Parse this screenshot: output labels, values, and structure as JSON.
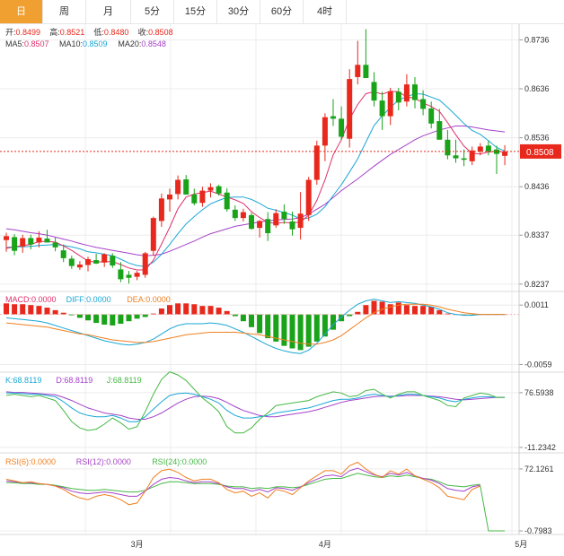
{
  "tabs": [
    {
      "label": "日",
      "active": true
    },
    {
      "label": "周",
      "active": false
    },
    {
      "label": "月",
      "active": false
    },
    {
      "label": "5分",
      "active": false
    },
    {
      "label": "15分",
      "active": false
    },
    {
      "label": "30分",
      "active": false
    },
    {
      "label": "60分",
      "active": false
    },
    {
      "label": "4时",
      "active": false
    }
  ],
  "colors": {
    "up": "#e8281c",
    "down": "#19a319",
    "ma5": "#e0306a",
    "ma10": "#1aa7d6",
    "ma20": "#a542c8",
    "macd": "#e0306a",
    "diff": "#1aa7d6",
    "dea": "#f08020",
    "k": "#1aa7d6",
    "d": "#a542c8",
    "j": "#45b845",
    "rsi6": "#f08020",
    "rsi12": "#a542c8",
    "rsi24": "#45b845",
    "accent": "#f0a030",
    "grid": "#ececec"
  },
  "legend": {
    "ohlc": [
      {
        "label": "开:",
        "value": "0.8499"
      },
      {
        "label": "高:",
        "value": "0.8521"
      },
      {
        "label": "低:",
        "value": "0.8480"
      },
      {
        "label": "收:",
        "value": "0.8508"
      }
    ],
    "ma": [
      {
        "label": "MA5:",
        "value": "0.8507",
        "color": "#e0306a"
      },
      {
        "label": "MA10:",
        "value": "0.8509",
        "color": "#1aa7d6"
      },
      {
        "label": "MA20:",
        "value": "0.8548",
        "color": "#a542c8"
      }
    ],
    "macd": [
      {
        "text": "MACD:0.0000",
        "color": "#e0306a"
      },
      {
        "text": "DIFF:0.0000",
        "color": "#1aa7d6"
      },
      {
        "text": "DEA:0.0000",
        "color": "#f08020"
      }
    ],
    "kdj": [
      {
        "text": "K:68.8119",
        "color": "#1aa7d6"
      },
      {
        "text": "D:68.8119",
        "color": "#a542c8"
      },
      {
        "text": "J:68.8119",
        "color": "#45b845"
      }
    ],
    "rsi": [
      {
        "text": "RSI(6):0.0000",
        "color": "#f08020"
      },
      {
        "text": "RSI(12):0.0000",
        "color": "#a542c8"
      },
      {
        "text": "RSI(24):0.0000",
        "color": "#45b845"
      }
    ]
  },
  "chart_data": {
    "type": "candlestick",
    "current_price": "0.8508",
    "x_labels": [
      {
        "i": 16,
        "text": "3月"
      },
      {
        "i": 39,
        "text": "4月"
      },
      {
        "i": 63,
        "text": "5月"
      }
    ],
    "price_axis": {
      "ticks": [
        "0.8736",
        "0.8636",
        "0.8536",
        "0.8436",
        "0.8337",
        "0.8237"
      ],
      "range": [
        0.8222,
        0.8768
      ]
    },
    "macd_axis": {
      "ticks": [
        "0.0011",
        "-0.0059"
      ],
      "range": [
        -0.0068,
        0.0026
      ]
    },
    "kdj_axis": {
      "ticks": [
        "76.5938",
        "-11.2342"
      ],
      "range": [
        -20,
        108
      ]
    },
    "rsi_axis": {
      "ticks": [
        "72.1261",
        "-0.7983"
      ],
      "range": [
        -5,
        90
      ]
    },
    "candles": [
      [
        0.8327,
        0.8342,
        0.8303,
        0.8335
      ],
      [
        0.8333,
        0.8339,
        0.8296,
        0.8305
      ],
      [
        0.8314,
        0.8338,
        0.8301,
        0.8331
      ],
      [
        0.8331,
        0.8338,
        0.8308,
        0.8318
      ],
      [
        0.8322,
        0.8345,
        0.8312,
        0.8332
      ],
      [
        0.833,
        0.8348,
        0.8322,
        0.8322
      ],
      [
        0.8322,
        0.8332,
        0.8304,
        0.8312
      ],
      [
        0.8306,
        0.8318,
        0.8282,
        0.829
      ],
      [
        0.8289,
        0.8295,
        0.8268,
        0.8274
      ],
      [
        0.8271,
        0.8284,
        0.8266,
        0.8277
      ],
      [
        0.8276,
        0.8293,
        0.8263,
        0.8288
      ],
      [
        0.8286,
        0.8299,
        0.8278,
        0.8279
      ],
      [
        0.8281,
        0.83,
        0.8272,
        0.8298
      ],
      [
        0.8295,
        0.83,
        0.827,
        0.8275
      ],
      [
        0.8267,
        0.8282,
        0.8241,
        0.8247
      ],
      [
        0.8256,
        0.8264,
        0.8238,
        0.825
      ],
      [
        0.8252,
        0.8264,
        0.8245,
        0.826
      ],
      [
        0.8256,
        0.8303,
        0.825,
        0.83
      ],
      [
        0.8305,
        0.8375,
        0.8295,
        0.8372
      ],
      [
        0.8366,
        0.8422,
        0.8354,
        0.8412
      ],
      [
        0.841,
        0.8432,
        0.8385,
        0.842
      ],
      [
        0.8421,
        0.8459,
        0.841,
        0.845
      ],
      [
        0.8451,
        0.846,
        0.842,
        0.842
      ],
      [
        0.842,
        0.8432,
        0.8398,
        0.8402
      ],
      [
        0.8403,
        0.8436,
        0.8395,
        0.8428
      ],
      [
        0.8428,
        0.8443,
        0.8414,
        0.8435
      ],
      [
        0.8437,
        0.844,
        0.8418,
        0.8422
      ],
      [
        0.8424,
        0.8433,
        0.8385,
        0.839
      ],
      [
        0.8389,
        0.8398,
        0.8366,
        0.8372
      ],
      [
        0.8372,
        0.8391,
        0.8365,
        0.8384
      ],
      [
        0.8378,
        0.8383,
        0.8348,
        0.835
      ],
      [
        0.8352,
        0.8368,
        0.8332,
        0.8366
      ],
      [
        0.837,
        0.8384,
        0.8325,
        0.8341
      ],
      [
        0.8357,
        0.839,
        0.8352,
        0.8382
      ],
      [
        0.8385,
        0.84,
        0.836,
        0.837
      ],
      [
        0.8365,
        0.8385,
        0.8336,
        0.8349
      ],
      [
        0.8352,
        0.8425,
        0.8328,
        0.8381
      ],
      [
        0.8378,
        0.8456,
        0.8366,
        0.845
      ],
      [
        0.845,
        0.853,
        0.844,
        0.852
      ],
      [
        0.852,
        0.8586,
        0.8488,
        0.8578
      ],
      [
        0.858,
        0.8615,
        0.856,
        0.8575
      ],
      [
        0.8575,
        0.86,
        0.8531,
        0.8538
      ],
      [
        0.8534,
        0.8676,
        0.8516,
        0.8656
      ],
      [
        0.866,
        0.8734,
        0.8645,
        0.8685
      ],
      [
        0.8685,
        0.8758,
        0.8662,
        0.8658
      ],
      [
        0.865,
        0.867,
        0.86,
        0.8612
      ],
      [
        0.8612,
        0.863,
        0.8552,
        0.858
      ],
      [
        0.858,
        0.8638,
        0.8562,
        0.8631
      ],
      [
        0.863,
        0.8638,
        0.8592,
        0.8608
      ],
      [
        0.861,
        0.8666,
        0.86,
        0.8645
      ],
      [
        0.8645,
        0.866,
        0.8596,
        0.8613
      ],
      [
        0.8615,
        0.8633,
        0.8582,
        0.8595
      ],
      [
        0.8596,
        0.861,
        0.8555,
        0.8565
      ],
      [
        0.857,
        0.8595,
        0.854,
        0.8532
      ],
      [
        0.8532,
        0.8552,
        0.8492,
        0.85
      ],
      [
        0.85,
        0.8532,
        0.8485,
        0.8494
      ],
      [
        0.8494,
        0.8512,
        0.8478,
        0.8491
      ],
      [
        0.8488,
        0.8518,
        0.848,
        0.851
      ],
      [
        0.8508,
        0.8525,
        0.85,
        0.8518
      ],
      [
        0.852,
        0.853,
        0.85,
        0.8508
      ],
      [
        0.8512,
        0.852,
        0.8462,
        0.8503
      ],
      [
        0.8499,
        0.8521,
        0.848,
        0.8508
      ]
    ],
    "ma5": [
      0.831,
      0.8313,
      0.8316,
      0.8318,
      0.8324,
      0.8324,
      0.8323,
      0.8315,
      0.8306,
      0.8295,
      0.8284,
      0.8282,
      0.8283,
      0.8283,
      0.8277,
      0.827,
      0.8266,
      0.8266,
      0.8286,
      0.8319,
      0.8353,
      0.8391,
      0.8415,
      0.8421,
      0.8424,
      0.8427,
      0.8421,
      0.8415,
      0.8409,
      0.8402,
      0.8385,
      0.8373,
      0.8363,
      0.8361,
      0.8363,
      0.8362,
      0.8364,
      0.8378,
      0.8408,
      0.845,
      0.8501,
      0.8532,
      0.8574,
      0.8604,
      0.8626,
      0.863,
      0.8625,
      0.8631,
      0.863,
      0.8619,
      0.8617,
      0.8607,
      0.86,
      0.859,
      0.8567,
      0.8542,
      0.8519,
      0.8504,
      0.8503,
      0.8507,
      0.8508,
      0.8507
    ],
    "ma10": [
      0.8312,
      0.8313,
      0.8313,
      0.8314,
      0.8316,
      0.8317,
      0.8318,
      0.8316,
      0.8313,
      0.8309,
      0.8303,
      0.8301,
      0.8298,
      0.8295,
      0.8288,
      0.828,
      0.8275,
      0.8273,
      0.8282,
      0.8298,
      0.8318,
      0.834,
      0.836,
      0.8375,
      0.8389,
      0.8401,
      0.8408,
      0.8414,
      0.8415,
      0.8415,
      0.841,
      0.8402,
      0.8392,
      0.8388,
      0.8383,
      0.8378,
      0.837,
      0.8372,
      0.838,
      0.8395,
      0.8418,
      0.844,
      0.8466,
      0.8493,
      0.8527,
      0.8561,
      0.8581,
      0.8598,
      0.8613,
      0.862,
      0.8626,
      0.8625,
      0.8619,
      0.8613,
      0.8598,
      0.8582,
      0.8565,
      0.8551,
      0.8543,
      0.853,
      0.8516,
      0.8509
    ],
    "ma20": [
      0.835,
      0.8348,
      0.8345,
      0.8342,
      0.834,
      0.8337,
      0.8333,
      0.8329,
      0.8325,
      0.832,
      0.8316,
      0.8312,
      0.8309,
      0.8306,
      0.8303,
      0.83,
      0.8297,
      0.8295,
      0.8296,
      0.8298,
      0.8304,
      0.8311,
      0.8318,
      0.8325,
      0.8333,
      0.834,
      0.8345,
      0.835,
      0.8355,
      0.8358,
      0.8361,
      0.8364,
      0.8366,
      0.8368,
      0.8369,
      0.837,
      0.8373,
      0.838,
      0.839,
      0.84,
      0.8414,
      0.8428,
      0.844,
      0.8452,
      0.8465,
      0.8478,
      0.849,
      0.8502,
      0.8512,
      0.8522,
      0.8532,
      0.854,
      0.8546,
      0.8552,
      0.8556,
      0.856,
      0.856,
      0.8558,
      0.8555,
      0.8552,
      0.855,
      0.8548
    ],
    "macd_hist": [
      0.0013,
      0.0012,
      0.0012,
      0.0011,
      0.001,
      0.0008,
      0.0005,
      0.0002,
      -0.0001,
      -0.0004,
      -0.0007,
      -0.001,
      -0.0012,
      -0.0013,
      -0.0011,
      -0.0008,
      -0.0005,
      -0.0003,
      0.0001,
      0.0007,
      0.0011,
      0.0013,
      0.0013,
      0.0012,
      0.001,
      0.001,
      0.0008,
      0.0004,
      -0.0002,
      -0.0008,
      -0.0015,
      -0.0022,
      -0.0028,
      -0.0032,
      -0.0037,
      -0.004,
      -0.0042,
      -0.0038,
      -0.0032,
      -0.0026,
      -0.0018,
      -0.0008,
      -0.0002,
      0.0003,
      0.0011,
      0.0016,
      0.0015,
      0.0012,
      0.0014,
      0.0011,
      0.001,
      0.001,
      0.0009,
      0.0005,
      0.0001,
      0.0,
      -0.0001,
      -0.0001,
      0.0,
      0.0,
      0.0,
      0.0
    ],
    "diff": [
      -0.0004,
      -0.0005,
      -0.0006,
      -0.0007,
      -0.0008,
      -0.001,
      -0.0013,
      -0.0016,
      -0.0019,
      -0.0022,
      -0.0025,
      -0.0028,
      -0.0031,
      -0.0033,
      -0.0035,
      -0.0036,
      -0.0035,
      -0.0033,
      -0.0029,
      -0.0023,
      -0.0017,
      -0.0013,
      -0.0011,
      -0.0011,
      -0.0011,
      -0.001,
      -0.0011,
      -0.0013,
      -0.0017,
      -0.0021,
      -0.0026,
      -0.0031,
      -0.0036,
      -0.004,
      -0.0043,
      -0.0045,
      -0.0046,
      -0.0042,
      -0.0034,
      -0.0023,
      -0.0012,
      -0.0003,
      0.0005,
      0.0012,
      0.0016,
      0.0018,
      0.0016,
      0.0014,
      0.0015,
      0.0014,
      0.0013,
      0.0011,
      0.0009,
      0.0006,
      0.0002,
      0.0,
      -0.0001,
      -0.0001,
      0.0,
      0.0,
      0.0,
      0.0
    ],
    "dea": [
      -0.001,
      -0.0011,
      -0.0012,
      -0.0013,
      -0.0014,
      -0.0015,
      -0.0017,
      -0.0019,
      -0.0021,
      -0.0023,
      -0.0024,
      -0.0026,
      -0.0028,
      -0.003,
      -0.0031,
      -0.0032,
      -0.0033,
      -0.0033,
      -0.0032,
      -0.003,
      -0.0028,
      -0.0026,
      -0.0024,
      -0.0023,
      -0.0022,
      -0.0021,
      -0.0021,
      -0.0021,
      -0.0021,
      -0.0022,
      -0.0023,
      -0.0024,
      -0.0026,
      -0.0028,
      -0.003,
      -0.0032,
      -0.0034,
      -0.0035,
      -0.0035,
      -0.0033,
      -0.003,
      -0.0025,
      -0.0018,
      -0.0011,
      -0.0004,
      0.0002,
      0.0006,
      0.0009,
      0.0011,
      0.0012,
      0.0012,
      0.0012,
      0.0011,
      0.0009,
      0.0006,
      0.0004,
      0.0002,
      0.0001,
      0.0,
      0.0,
      0.0,
      0.0
    ],
    "k": [
      76,
      76,
      75,
      74,
      74,
      72,
      70,
      62,
      52,
      44,
      40,
      38,
      38,
      40,
      36,
      30,
      30,
      38,
      50,
      62,
      72,
      75,
      76,
      74,
      70,
      66,
      60,
      48,
      40,
      36,
      36,
      38,
      40,
      44,
      46,
      48,
      50,
      52,
      56,
      60,
      64,
      66,
      66,
      68,
      72,
      74,
      72,
      70,
      72,
      74,
      74,
      72,
      70,
      68,
      64,
      62,
      66,
      68,
      70,
      70,
      69,
      69
    ],
    "d": [
      78,
      77,
      77,
      76,
      75,
      74,
      73,
      69,
      64,
      58,
      52,
      48,
      44,
      42,
      40,
      36,
      34,
      34,
      38,
      44,
      52,
      60,
      66,
      70,
      71,
      70,
      67,
      61,
      54,
      48,
      44,
      40,
      38,
      38,
      40,
      42,
      44,
      46,
      49,
      53,
      57,
      61,
      64,
      66,
      68,
      70,
      71,
      71,
      71,
      72,
      72,
      72,
      71,
      70,
      68,
      66,
      65,
      66,
      67,
      68,
      69,
      69
    ],
    "j": [
      72,
      74,
      72,
      70,
      72,
      68,
      64,
      48,
      30,
      20,
      16,
      18,
      26,
      36,
      28,
      18,
      22,
      46,
      74,
      98,
      110,
      105,
      96,
      82,
      68,
      58,
      46,
      22,
      12,
      12,
      20,
      34,
      44,
      56,
      58,
      60,
      62,
      64,
      70,
      74,
      78,
      76,
      70,
      72,
      80,
      82,
      74,
      68,
      74,
      78,
      78,
      72,
      68,
      64,
      56,
      54,
      68,
      72,
      76,
      74,
      69,
      69
    ],
    "rsi6": [
      60,
      58,
      56,
      57,
      55,
      54,
      52,
      48,
      42,
      38,
      36,
      40,
      42,
      40,
      36,
      30,
      32,
      46,
      62,
      70,
      72,
      68,
      62,
      58,
      60,
      60,
      56,
      48,
      44,
      46,
      40,
      44,
      38,
      48,
      46,
      42,
      50,
      58,
      64,
      70,
      70,
      66,
      76,
      80,
      72,
      66,
      62,
      70,
      66,
      72,
      64,
      60,
      56,
      50,
      40,
      38,
      36,
      48,
      52,
      -1,
      -1,
      -1
    ],
    "rsi12": [
      58,
      57,
      56,
      56,
      55,
      54,
      52,
      50,
      46,
      44,
      43,
      44,
      45,
      44,
      42,
      40,
      40,
      46,
      54,
      60,
      62,
      61,
      58,
      56,
      57,
      57,
      55,
      51,
      49,
      49,
      46,
      48,
      45,
      50,
      49,
      47,
      51,
      56,
      60,
      64,
      65,
      63,
      70,
      73,
      69,
      65,
      63,
      67,
      65,
      68,
      64,
      61,
      59,
      55,
      49,
      47,
      46,
      51,
      53,
      -1,
      -1,
      -1
    ],
    "rsi24": [
      56,
      56,
      55,
      55,
      54,
      54,
      53,
      51,
      49,
      48,
      47,
      47,
      48,
      47,
      46,
      45,
      45,
      47,
      51,
      55,
      57,
      57,
      56,
      55,
      55,
      55,
      54,
      52,
      51,
      51,
      49,
      50,
      49,
      51,
      51,
      50,
      51,
      54,
      57,
      60,
      61,
      61,
      64,
      67,
      65,
      63,
      62,
      64,
      63,
      65,
      63,
      61,
      60,
      57,
      53,
      52,
      51,
      53,
      54,
      -1,
      -1,
      -1
    ]
  }
}
